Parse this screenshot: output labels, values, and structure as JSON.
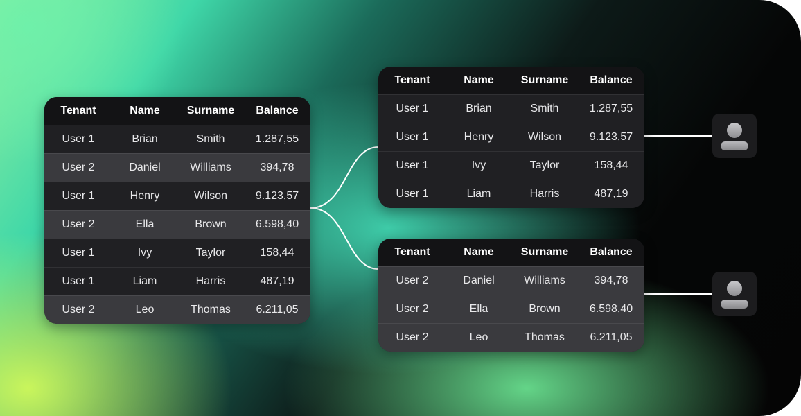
{
  "columns": [
    "Tenant",
    "Name",
    "Surname",
    "Balance"
  ],
  "main_table": [
    [
      "User 1",
      "Brian",
      "Smith",
      "1.287,55"
    ],
    [
      "User 2",
      "Daniel",
      "Williams",
      "394,78"
    ],
    [
      "User 1",
      "Henry",
      "Wilson",
      "9.123,57"
    ],
    [
      "User 2",
      "Ella",
      "Brown",
      "6.598,40"
    ],
    [
      "User 1",
      "Ivy",
      "Taylor",
      "158,44"
    ],
    [
      "User 1",
      "Liam",
      "Harris",
      "487,19"
    ],
    [
      "User 2",
      "Leo",
      "Thomas",
      "6.211,05"
    ]
  ],
  "user1_table": [
    [
      "User 1",
      "Brian",
      "Smith",
      "1.287,55"
    ],
    [
      "User 1",
      "Henry",
      "Wilson",
      "9.123,57"
    ],
    [
      "User 1",
      "Ivy",
      "Taylor",
      "158,44"
    ],
    [
      "User 1",
      "Liam",
      "Harris",
      "487,19"
    ]
  ],
  "user2_table": [
    [
      "User 2",
      "Daniel",
      "Williams",
      "394,78"
    ],
    [
      "User 2",
      "Ella",
      "Brown",
      "6.598,40"
    ],
    [
      "User 2",
      "Leo",
      "Thomas",
      "6.211,05"
    ]
  ],
  "icons": {
    "user1_avatar": "user-avatar-icon",
    "user2_avatar": "user-avatar-icon"
  },
  "colors": {
    "card_background": "#232326",
    "header_background": "#131315",
    "row_highlight": "#3a3a3e",
    "connector_line": "#ffffff"
  }
}
